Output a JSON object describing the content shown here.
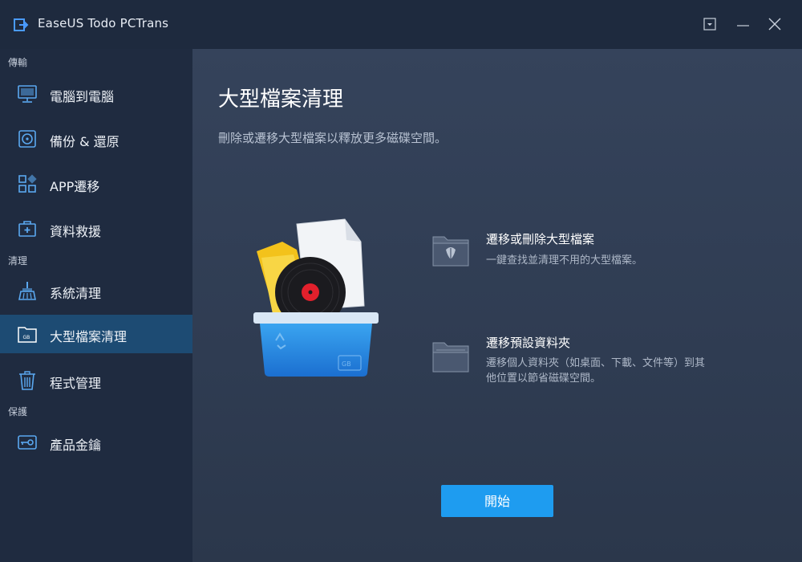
{
  "app": {
    "title": "EaseUS Todo PCTrans"
  },
  "sidebar": {
    "sections": [
      {
        "label": "傳輸"
      },
      {
        "label": "清理"
      },
      {
        "label": "保護"
      }
    ],
    "items": [
      {
        "label": "電腦到電腦",
        "icon": "monitor-icon"
      },
      {
        "label": "備份 & 還原",
        "icon": "backup-disk-icon"
      },
      {
        "label": "APP遷移",
        "icon": "apps-grid-icon"
      },
      {
        "label": "資料救援",
        "icon": "first-aid-kit-icon"
      },
      {
        "label": "系統清理",
        "icon": "broom-icon"
      },
      {
        "label": "大型檔案清理",
        "icon": "large-file-folder-icon",
        "active": true
      },
      {
        "label": "程式管理",
        "icon": "trash-bin-icon"
      },
      {
        "label": "產品金鑰",
        "icon": "key-icon"
      }
    ]
  },
  "main": {
    "title": "大型檔案清理",
    "subtitle": "刪除或遷移大型檔案以釋放更多磁碟空間。",
    "features": [
      {
        "title": "遷移或刪除大型檔案",
        "desc": "一鍵查找並清理不用的大型檔案。",
        "icon": "folder-leaf-icon"
      },
      {
        "title": "遷移預設資料夾",
        "desc_line1": "遷移個人資料夾（如桌面、下載、文件等）到其",
        "desc_line2": "他位置以節省磁碟空間。",
        "icon": "folder-icon"
      }
    ],
    "start_label": "開始"
  },
  "colors": {
    "accent": "#1e9cf0",
    "active_nav": "#1d4b73",
    "sidebar_bg": "#1f2b40"
  }
}
